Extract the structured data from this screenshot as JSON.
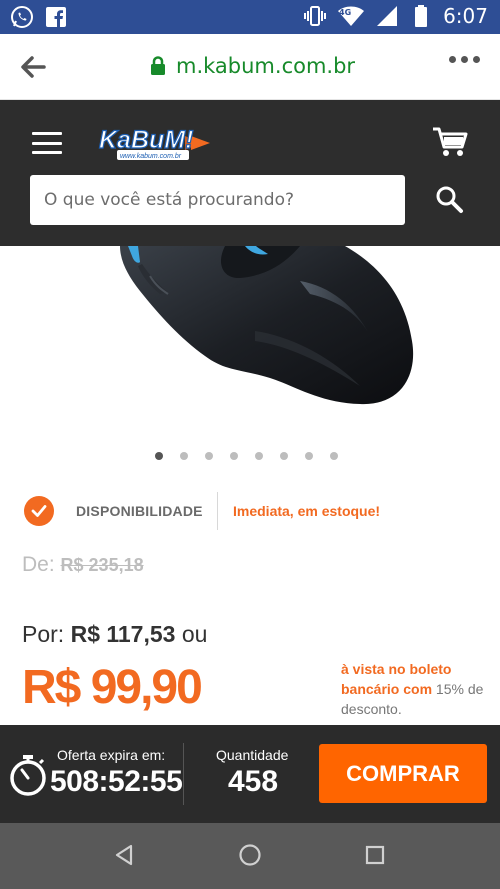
{
  "status_bar": {
    "time": "6:07",
    "network": "4G",
    "icons": [
      "whatsapp-icon",
      "facebook-icon",
      "vibrate-icon",
      "wifi-icon",
      "signal-icon",
      "battery-icon"
    ]
  },
  "browser": {
    "url": "m.kabum.com.br"
  },
  "header": {
    "search_placeholder": "O que você está procurando?",
    "logo_text": "KaBuM!",
    "logo_sub": "www.kabum.com.br"
  },
  "carousel": {
    "total": 8,
    "active": 1
  },
  "availability": {
    "label": "DISPONIBILIDADE",
    "value": "Imediata, em estoque!"
  },
  "pricing": {
    "old_prefix": "De:",
    "old_price": "R$ 235,18",
    "por_prefix": "Por:",
    "por_price": "R$ 117,53",
    "por_suffix": "ou",
    "big_price": "R$ 99,90",
    "boleto_highlight": "à vista no boleto bancário com",
    "boleto_rest": "15% de desconto."
  },
  "footer": {
    "offer_label": "Oferta expira em:",
    "offer_time": "508:52:55",
    "qty_label": "Quantidade",
    "qty_value": "458",
    "buy_label": "COMPRAR"
  },
  "colors": {
    "brand_orange": "#f26a21",
    "header_dark": "#2d2d2d",
    "status_blue": "#2e4e95"
  }
}
